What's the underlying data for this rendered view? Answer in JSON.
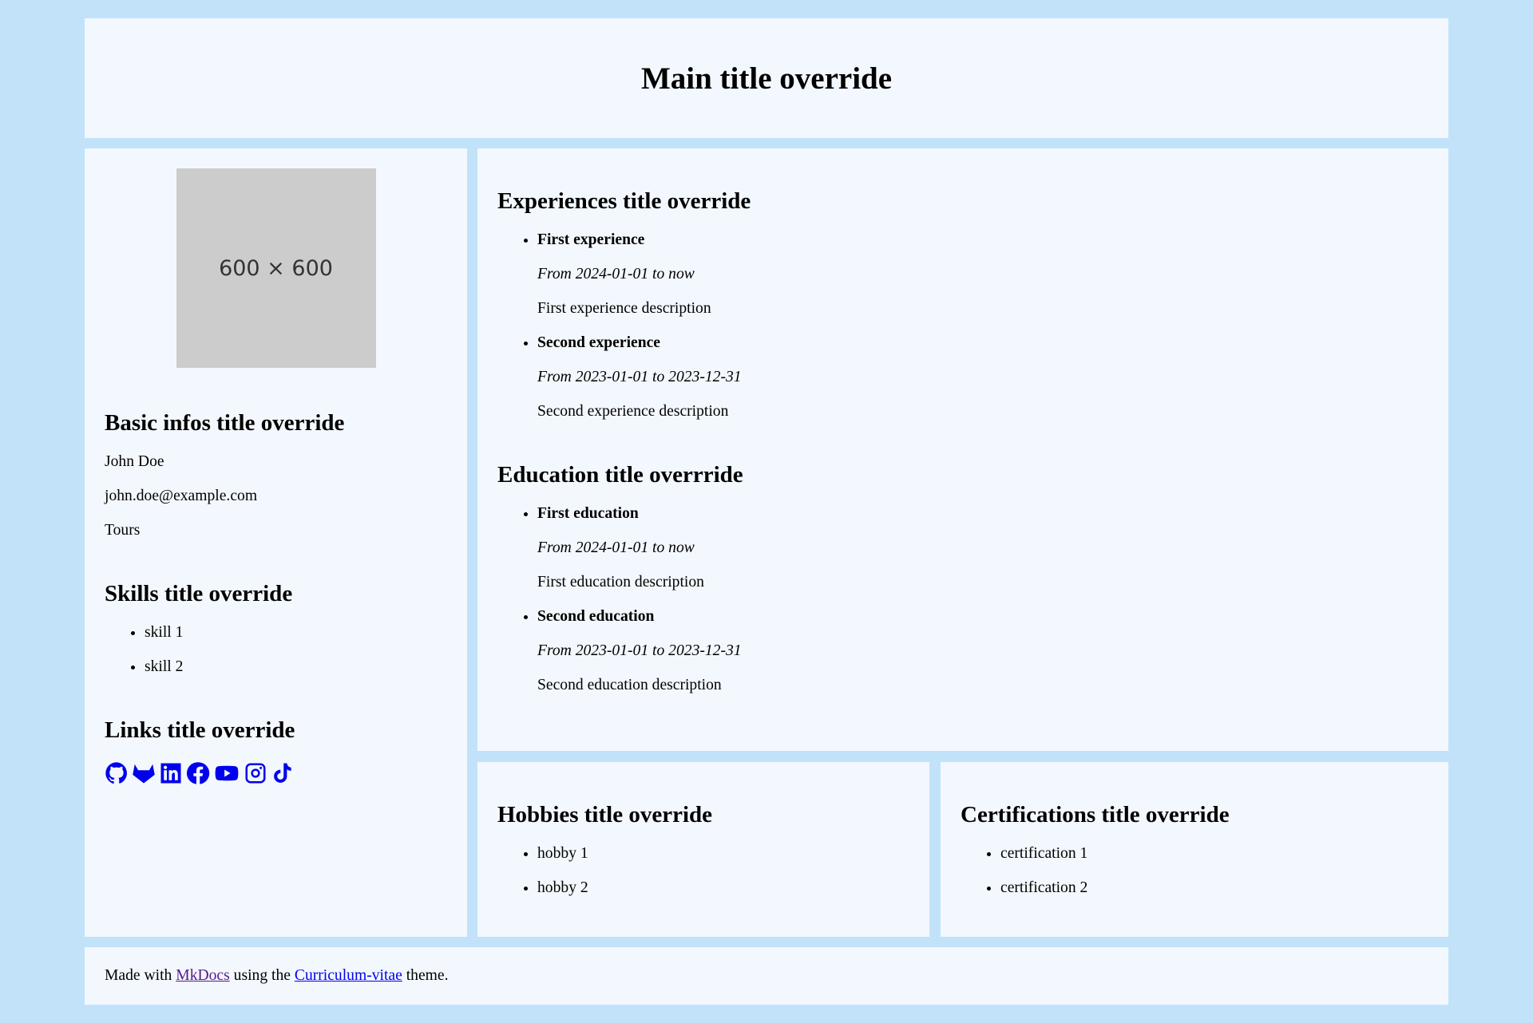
{
  "header": {
    "title": "Main title override"
  },
  "photo": {
    "placeholder": "600 × 600"
  },
  "basic": {
    "title": "Basic infos title override",
    "name": "John Doe",
    "email": "john.doe@example.com",
    "city": "Tours"
  },
  "skills": {
    "title": "Skills title override",
    "items": [
      "skill 1",
      "skill 2"
    ]
  },
  "links": {
    "title": "Links title override",
    "icons": [
      "github-icon",
      "gitlab-icon",
      "linkedin-icon",
      "facebook-icon",
      "youtube-icon",
      "instagram-icon",
      "tiktok-icon"
    ]
  },
  "experiences": {
    "title": "Experiences title override",
    "items": [
      {
        "name": "First experience",
        "dates": "From 2024-01-01 to now",
        "description": "First experience description"
      },
      {
        "name": "Second experience",
        "dates": "From 2023-01-01 to 2023-12-31",
        "description": "Second experience description"
      }
    ]
  },
  "education": {
    "title": "Education title overrride",
    "items": [
      {
        "name": "First education",
        "dates": "From 2024-01-01 to now",
        "description": "First education description"
      },
      {
        "name": "Second education",
        "dates": "From 2023-01-01 to 2023-12-31",
        "description": "Second education description"
      }
    ]
  },
  "hobbies": {
    "title": "Hobbies title override",
    "items": [
      "hobby 1",
      "hobby 2"
    ]
  },
  "certifications": {
    "title": "Certifications title override",
    "items": [
      "certification 1",
      "certification 2"
    ]
  },
  "footer": {
    "prefix": "Made with",
    "link1": "MkDocs",
    "middle": "using the",
    "link2": "Curriculum-vitae",
    "suffix": "theme."
  },
  "colors": {
    "background": "#c2e2fa",
    "panel": "#f3f8fe",
    "link": "#0000ee",
    "visited": "#551a8b"
  }
}
